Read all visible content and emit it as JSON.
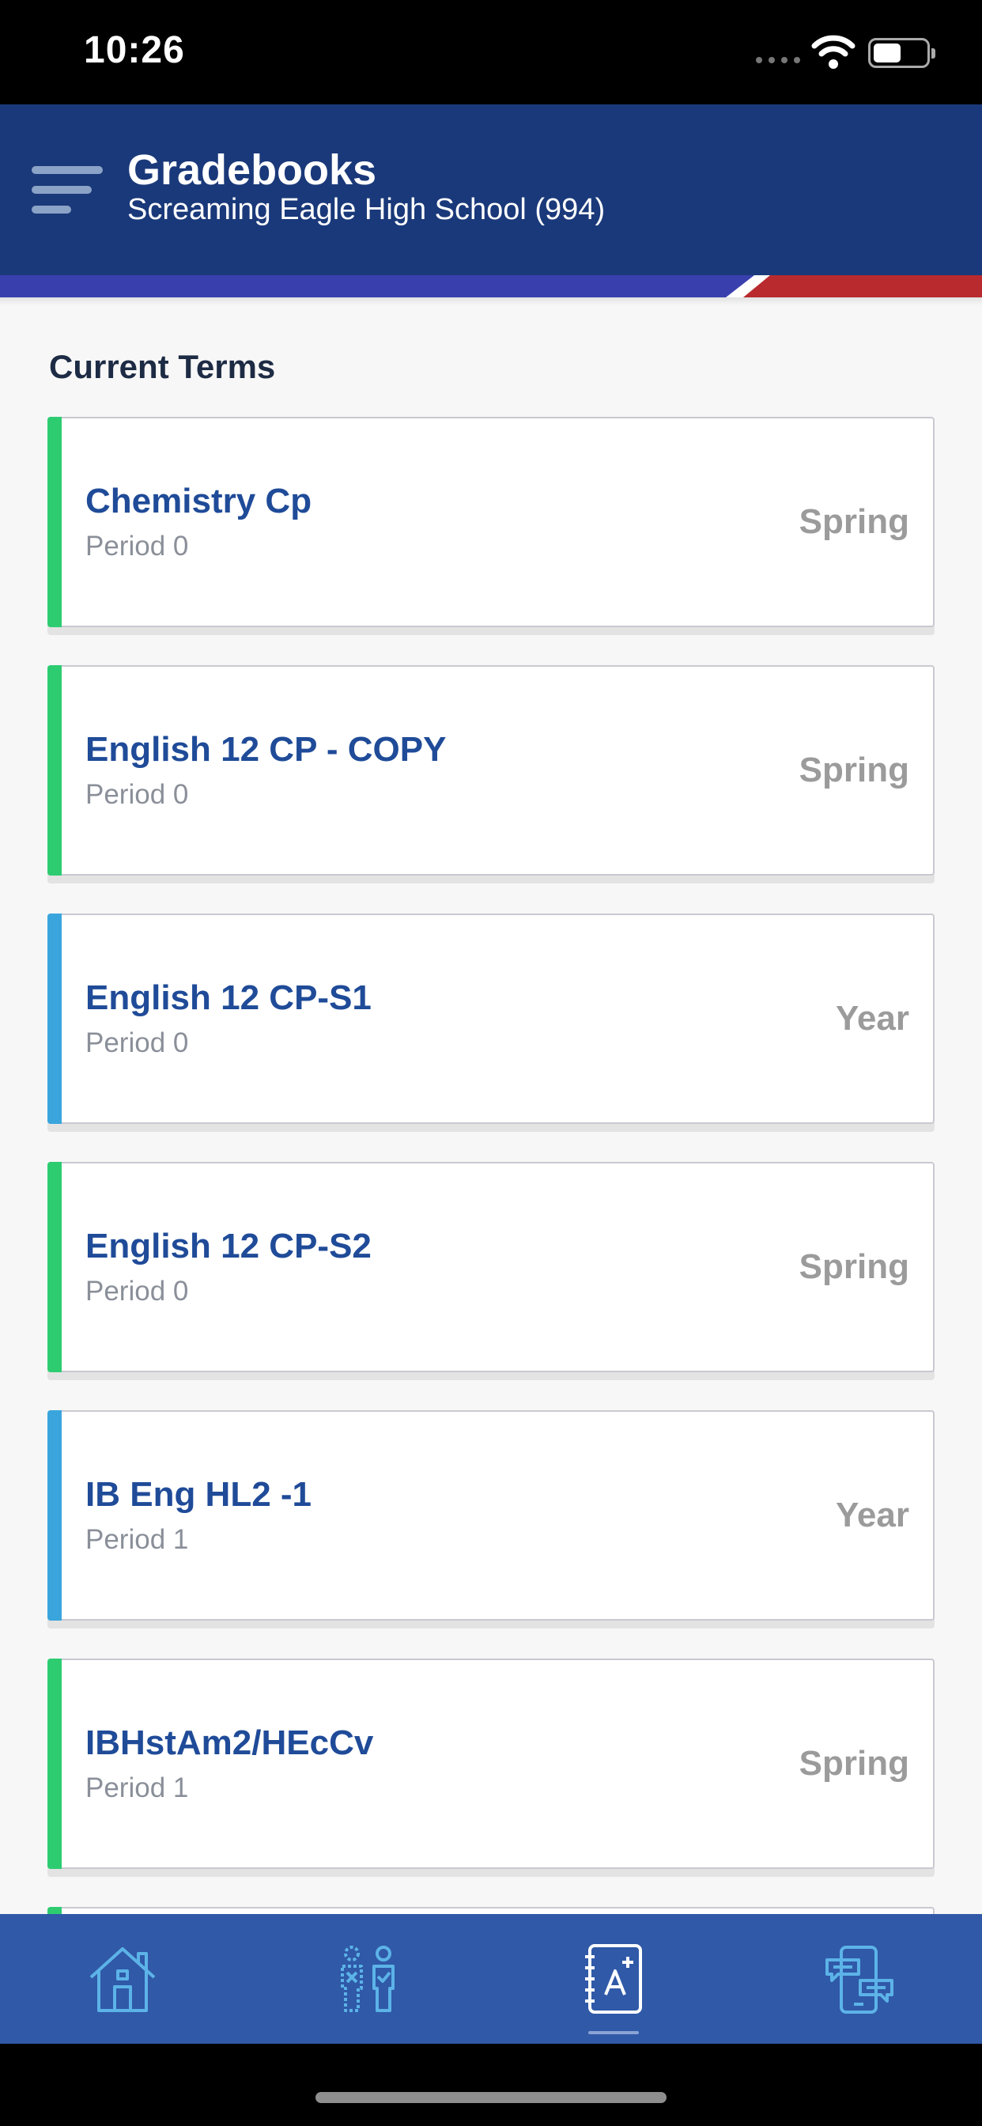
{
  "status_bar": {
    "time": "10:26"
  },
  "header": {
    "title": "Gradebooks",
    "subtitle": "Screaming Eagle High School (994)"
  },
  "colors": {
    "header_bg": "#1a397a",
    "nav_bg": "#3059a8",
    "accent_green": "#2ecc71",
    "accent_blue": "#3aa5dd",
    "title_blue": "#1f4b98"
  },
  "section_title": "Current Terms",
  "courses": [
    {
      "name": "Chemistry Cp",
      "period": "Period 0",
      "term": "Spring",
      "accent": "green"
    },
    {
      "name": "English 12 CP - COPY",
      "period": "Period 0",
      "term": "Spring",
      "accent": "green"
    },
    {
      "name": "English 12 CP-S1",
      "period": "Period 0",
      "term": "Year",
      "accent": "blue"
    },
    {
      "name": "English 12 CP-S2",
      "period": "Period 0",
      "term": "Spring",
      "accent": "green"
    },
    {
      "name": "IB Eng HL2 -1",
      "period": "Period 1",
      "term": "Year",
      "accent": "blue"
    },
    {
      "name": "IBHstAm2/HEcCv",
      "period": "Period 1",
      "term": "Spring",
      "accent": "green"
    },
    {
      "name": "",
      "period": "",
      "term": "",
      "accent": "green"
    }
  ],
  "bottom_nav": [
    {
      "icon": "home-icon",
      "active": false
    },
    {
      "icon": "attendance-icon",
      "active": false
    },
    {
      "icon": "gradebook-icon",
      "active": true
    },
    {
      "icon": "messages-icon",
      "active": false
    }
  ]
}
